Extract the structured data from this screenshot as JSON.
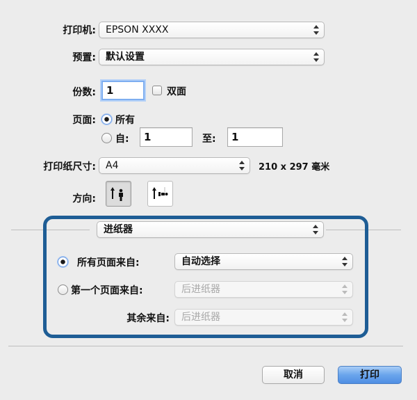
{
  "printer": {
    "label": "打印机:",
    "value": "EPSON XXXX"
  },
  "presets": {
    "label": "预置:",
    "value": "默认设置"
  },
  "copies": {
    "label": "份数:",
    "value": "1",
    "duplex_label": "双面"
  },
  "pages": {
    "label": "页面:",
    "all_label": "所有",
    "from_label": "自:",
    "from_value": "1",
    "to_label": "至:",
    "to_value": "1"
  },
  "paper_size": {
    "label": "打印纸尺寸:",
    "value": "A4",
    "dimensions": "210 x 297 毫米"
  },
  "orientation": {
    "label": "方向:",
    "selected": "portrait"
  },
  "section_menu": {
    "value": "进纸器"
  },
  "paper_feed": {
    "all_pages": {
      "label": "所有页面来自:",
      "value": "自动选择",
      "selected": true
    },
    "first_page": {
      "label": "第一个页面来自:",
      "value": "后进纸器",
      "selected": false
    },
    "remaining": {
      "label": "其余来自:",
      "value": "后进纸器"
    }
  },
  "buttons": {
    "cancel": "取消",
    "print": "打印"
  },
  "colors": {
    "highlight_border": "#1e5d95",
    "default_button": "#6aa5ec",
    "focus_ring": "#7eaef0"
  }
}
